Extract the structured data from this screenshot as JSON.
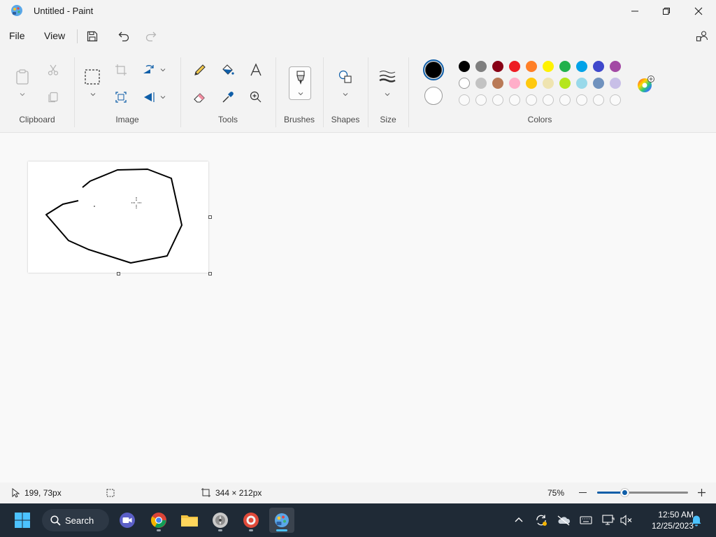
{
  "window": {
    "title": "Untitled - Paint"
  },
  "menu": {
    "file": "File",
    "view": "View"
  },
  "ribbon": {
    "groups": {
      "clipboard": "Clipboard",
      "image": "Image",
      "tools": "Tools",
      "brushes": "Brushes",
      "shapes": "Shapes",
      "size": "Size",
      "colors": "Colors"
    },
    "palette": {
      "row1": [
        "#000000",
        "#7f7f7f",
        "#880015",
        "#ed1c24",
        "#ff7f27",
        "#fff200",
        "#22b14c",
        "#00a2e8",
        "#3f48cc",
        "#a349a4"
      ],
      "row2": [
        "#ffffff",
        "#c3c3c3",
        "#b97a57",
        "#ffaec9",
        "#ffc90e",
        "#efe4b0",
        "#b5e61d",
        "#99d9ea",
        "#7092be",
        "#c8bfe7"
      ],
      "row3_empty_count": 10
    },
    "primary_color": "#000000",
    "secondary_color": "#ffffff"
  },
  "status": {
    "cursor_position": "199, 73px",
    "canvas_size": "344 × 212px",
    "zoom": "75%",
    "zoom_level_fraction": 0.3
  },
  "taskbar": {
    "search_label": "Search",
    "time": "12:50 AM",
    "date": "12/25/2023"
  }
}
